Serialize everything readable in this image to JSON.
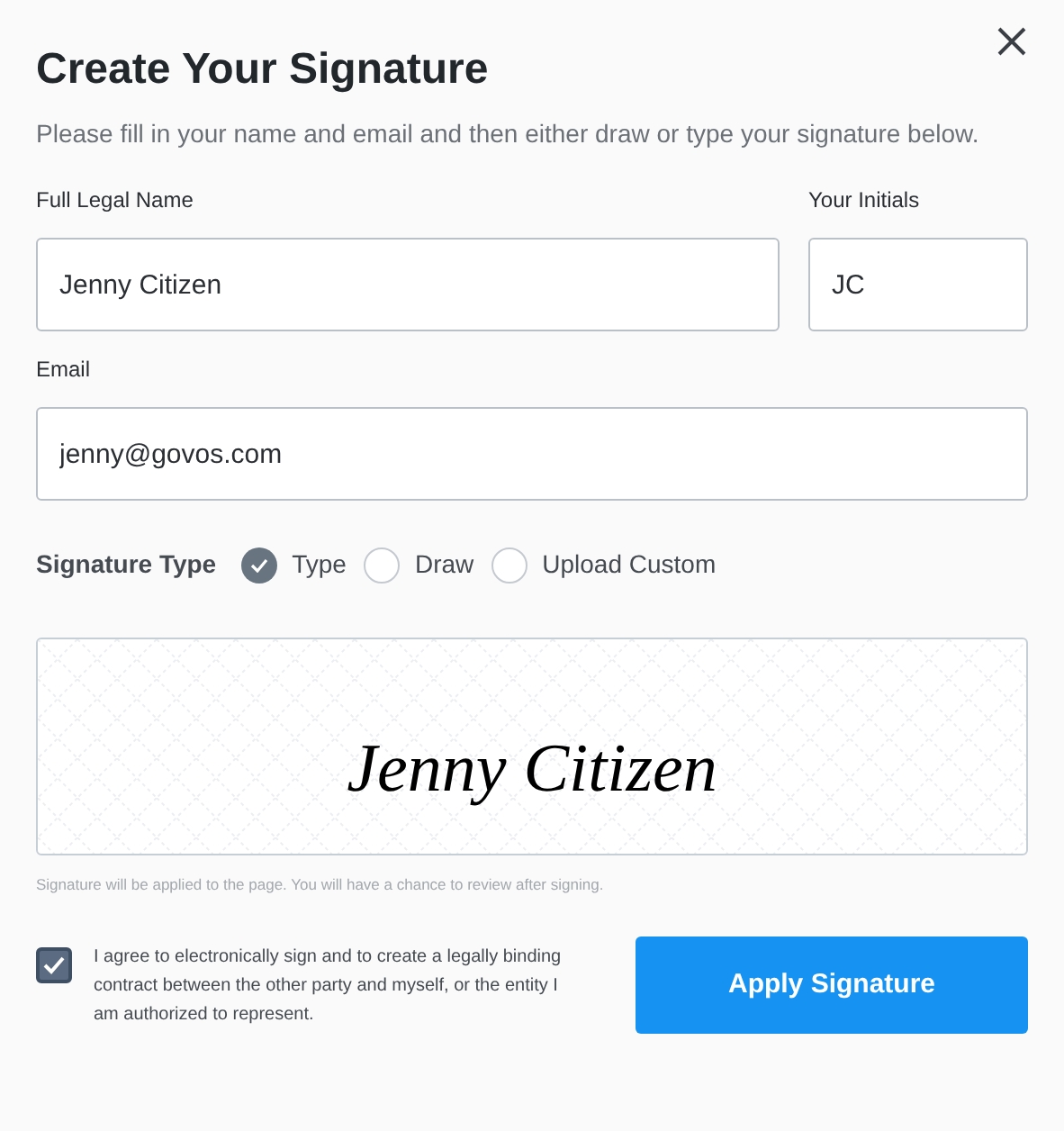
{
  "dialog": {
    "title": "Create Your Signature",
    "subtitle": "Please fill in your name and email and then either draw or type your signature below."
  },
  "fields": {
    "full_name": {
      "label": "Full Legal Name",
      "value": "Jenny Citizen"
    },
    "initials": {
      "label": "Your Initials",
      "value": "JC"
    },
    "email": {
      "label": "Email",
      "value": "jenny@govos.com"
    }
  },
  "signature_type": {
    "label": "Signature Type",
    "options": [
      {
        "label": "Type",
        "selected": true
      },
      {
        "label": "Draw",
        "selected": false
      },
      {
        "label": "Upload Custom",
        "selected": false
      }
    ]
  },
  "signature_preview": {
    "text": "Jenny Citizen",
    "note": "Signature will be applied to the page. You will have a chance to review after signing."
  },
  "agreement": {
    "checked": true,
    "text": "I agree to electronically sign and to create a legally binding contract between the other party and myself, or the entity I am authorized to represent."
  },
  "apply_button": "Apply Signature"
}
